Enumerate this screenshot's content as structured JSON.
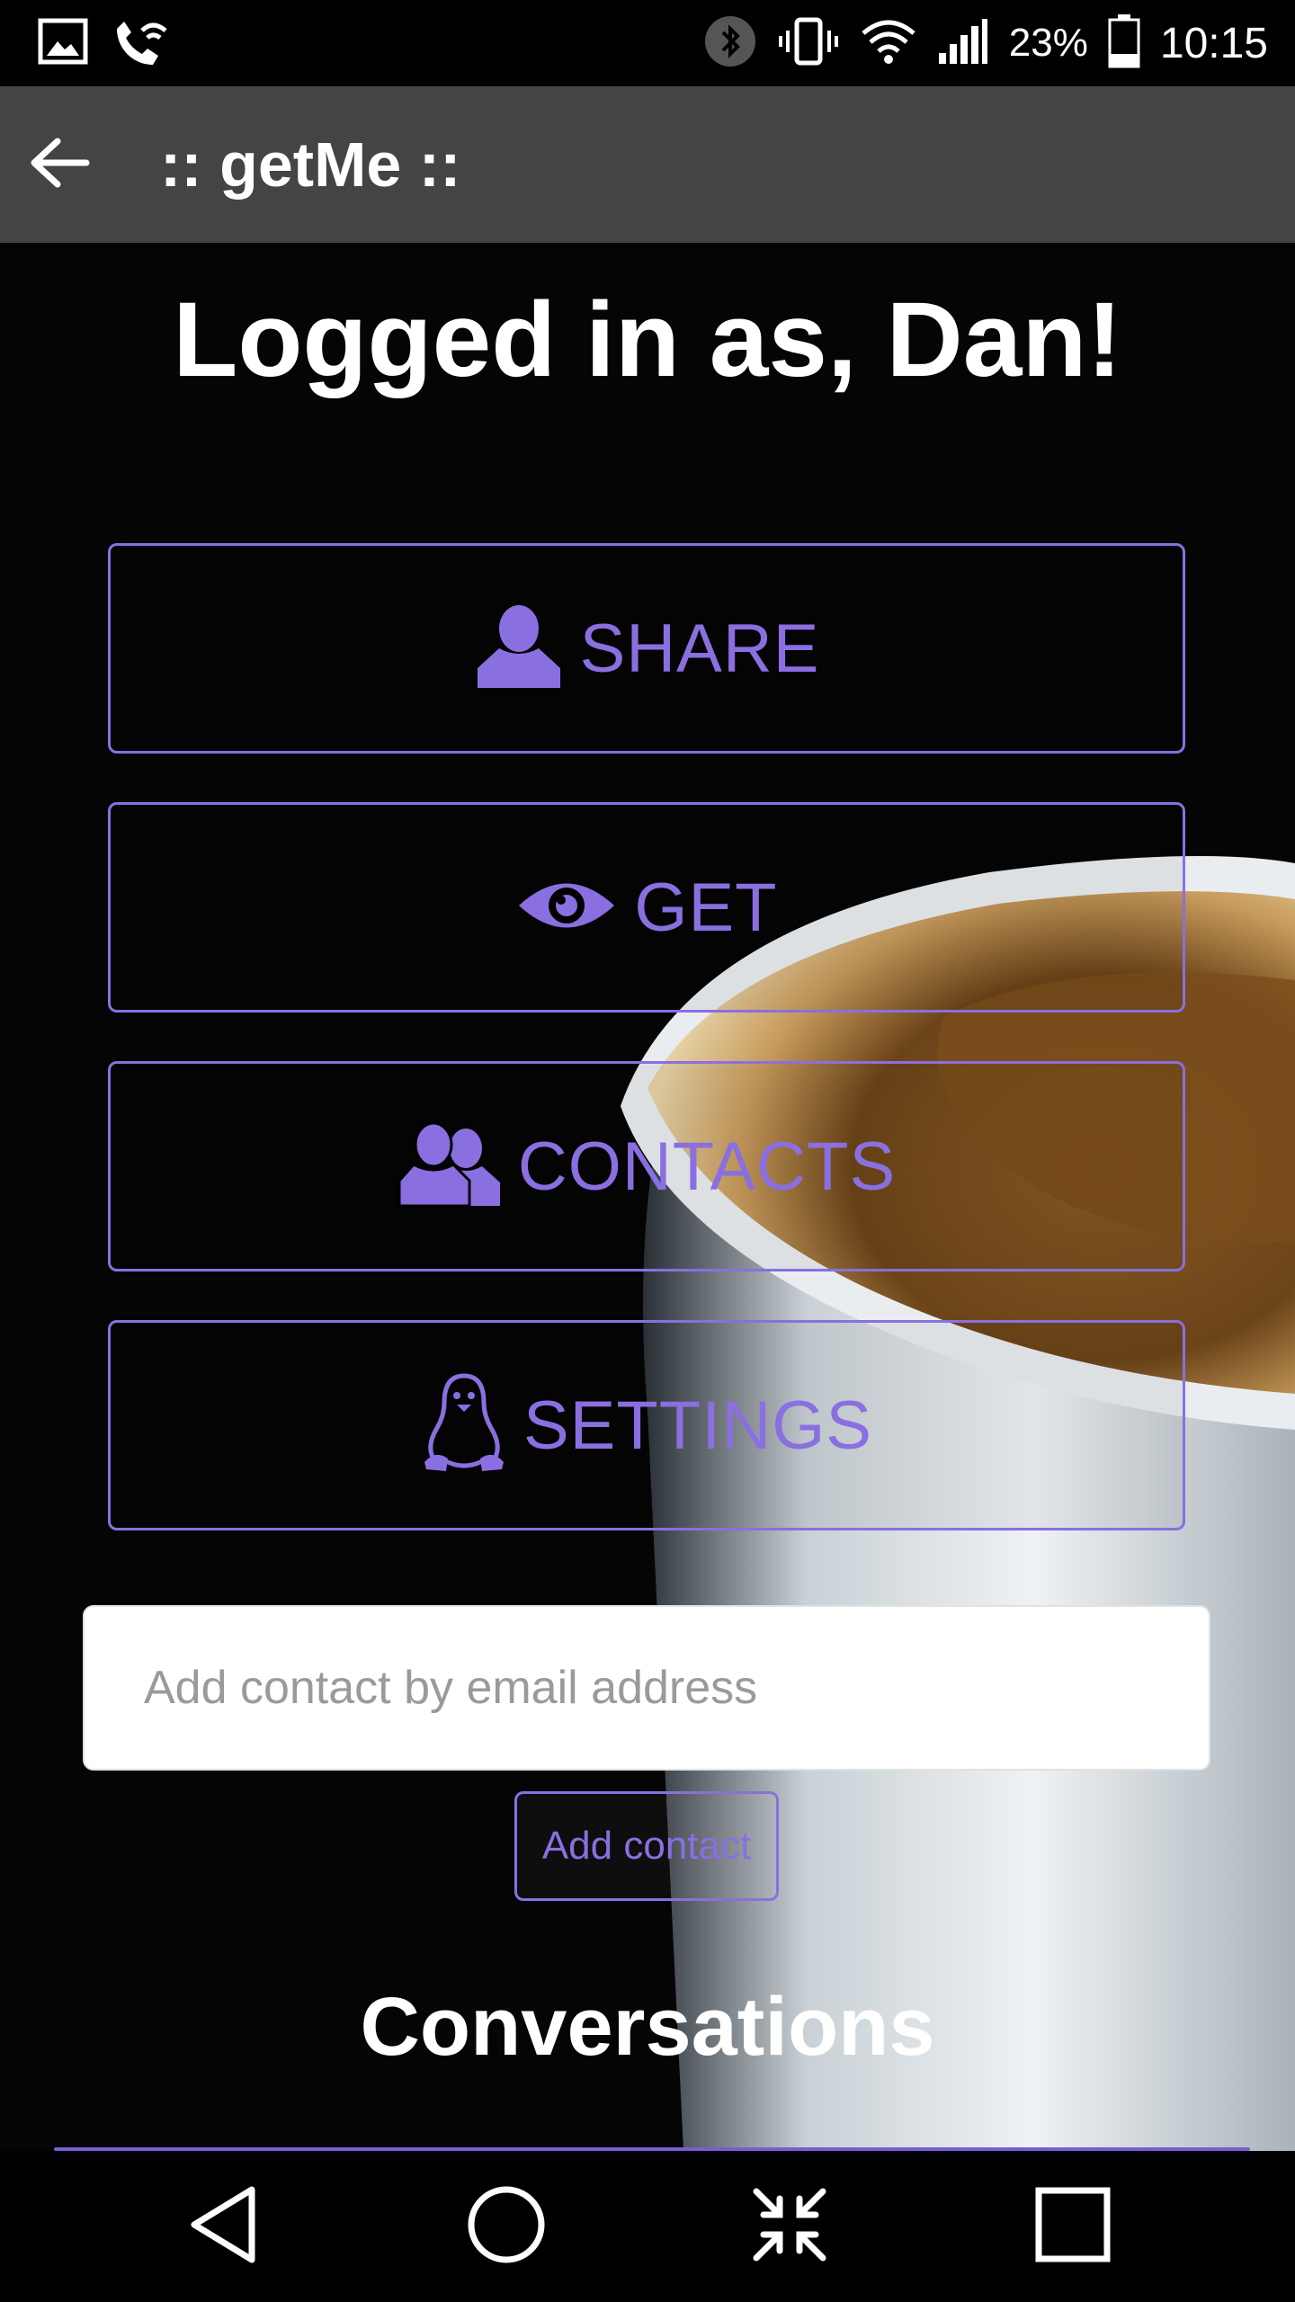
{
  "status_bar": {
    "battery": "23%",
    "time": "10:15",
    "icons": [
      "gallery-icon",
      "wifi-calling-icon",
      "bluetooth-icon",
      "vibrate-icon",
      "wifi-icon",
      "signal-icon",
      "battery-icon"
    ]
  },
  "app_bar": {
    "back_icon": "arrow-back-icon",
    "title": ":: getMe ::"
  },
  "greeting": "Logged in as, Dan!",
  "menu": [
    {
      "label": "SHARE",
      "icon": "person-icon"
    },
    {
      "label": "GET",
      "icon": "eye-icon"
    },
    {
      "label": "CONTACTS",
      "icon": "contacts-icon"
    },
    {
      "label": "SETTINGS",
      "icon": "penguin-icon"
    }
  ],
  "add_contact": {
    "placeholder": "Add contact by email address",
    "value": "",
    "button_label": "Add contact"
  },
  "conversations_heading": "Conversations",
  "nav_bar": {
    "buttons": [
      "back-triangle-icon",
      "home-circle-icon",
      "collapse-arrows-icon",
      "recents-square-icon"
    ]
  },
  "colors": {
    "accent": "#8a6fe0",
    "app_bar": "#444444",
    "background": "#000000"
  }
}
